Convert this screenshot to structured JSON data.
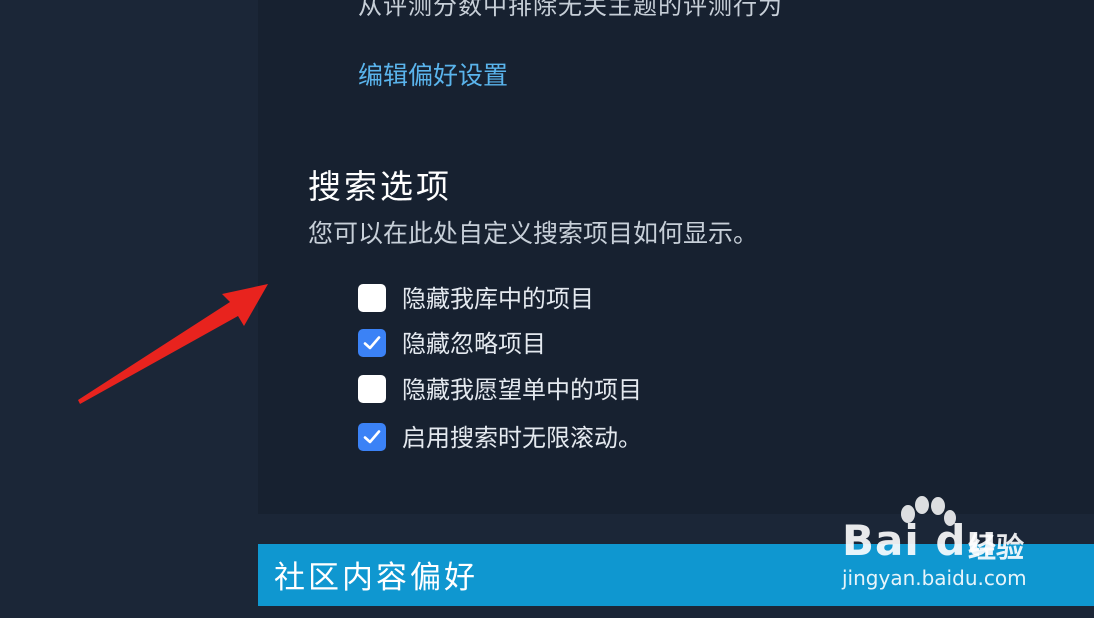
{
  "preferences": {
    "exclude_text": "从评测分数中排除无关主题的评测行为",
    "edit_link": "编辑偏好设置"
  },
  "search_options": {
    "title": "搜索选项",
    "description": "您可以在此处自定义搜索项目如何显示。",
    "options": [
      {
        "label": "隐藏我库中的项目",
        "checked": false
      },
      {
        "label": "隐藏忽略项目",
        "checked": true
      },
      {
        "label": "隐藏我愿望单中的项目",
        "checked": false
      },
      {
        "label": "启用搜索时无限滚动。",
        "checked": true
      }
    ]
  },
  "community": {
    "title": "社区内容偏好"
  },
  "watermark": {
    "brand": "Bai du",
    "suffix": "经验",
    "url": "jingyan.baidu.com"
  },
  "colors": {
    "panel_bg": "#172130",
    "page_bg": "#1b2637",
    "link": "#5ab4ec",
    "checkbox_checked": "#3b82f6",
    "community_bar": "#0f97d0",
    "arrow": "#e8231e"
  }
}
